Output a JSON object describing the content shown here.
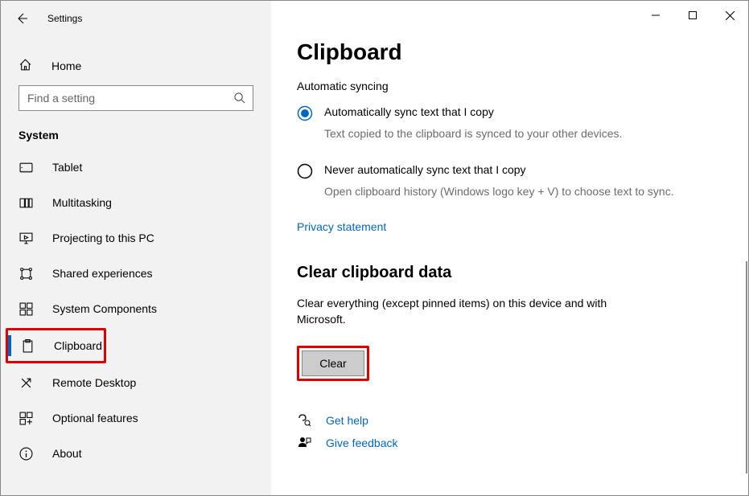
{
  "titlebar": {
    "title": "Settings"
  },
  "home_label": "Home",
  "search": {
    "placeholder": "Find a setting"
  },
  "group_label": "System",
  "nav": [
    {
      "label": "Tablet"
    },
    {
      "label": "Multitasking"
    },
    {
      "label": "Projecting to this PC"
    },
    {
      "label": "Shared experiences"
    },
    {
      "label": "System Components"
    },
    {
      "label": "Clipboard"
    },
    {
      "label": "Remote Desktop"
    },
    {
      "label": "Optional features"
    },
    {
      "label": "About"
    }
  ],
  "page": {
    "title": "Clipboard",
    "sync_heading": "Automatic syncing",
    "radio1": {
      "label": "Automatically sync text that I copy",
      "desc": "Text copied to the clipboard is synced to your other devices."
    },
    "radio2": {
      "label": "Never automatically sync text that I copy",
      "desc": "Open clipboard history (Windows logo key + V) to choose text to sync."
    },
    "privacy_link": "Privacy statement",
    "clear_heading": "Clear clipboard data",
    "clear_desc": "Clear everything (except pinned items) on this device and with Microsoft.",
    "clear_btn": "Clear",
    "help_link": "Get help",
    "feedback_link": "Give feedback"
  }
}
